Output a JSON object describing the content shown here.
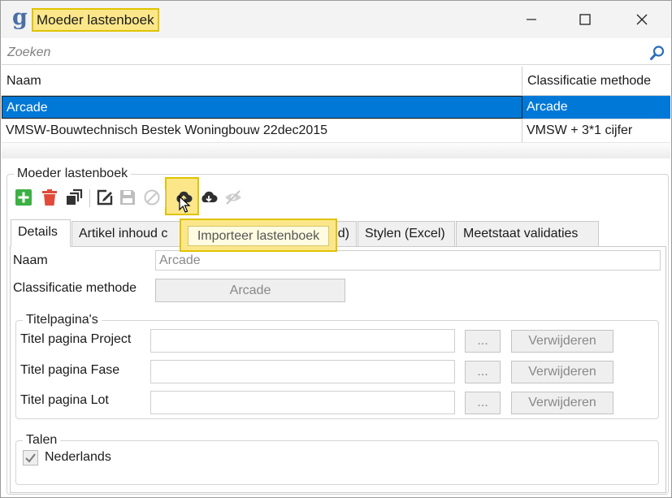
{
  "window": {
    "title": "Moeder lastenboek",
    "logo_letter": "g",
    "controls": {
      "minimize": "minimize-icon",
      "maximize": "maximize-icon",
      "close": "close-icon"
    }
  },
  "search": {
    "placeholder": "Zoeken",
    "value": ""
  },
  "grid": {
    "columns": [
      "Naam",
      "Classificatie methode"
    ],
    "rows": [
      {
        "naam": "Arcade",
        "classificatie": "Arcade",
        "selected": true
      },
      {
        "naam": "VMSW-Bouwtechnisch Bestek Woningbouw 22dec2015",
        "classificatie": "VMSW + 3*1 cijfer",
        "selected": false
      }
    ]
  },
  "group_title": "Moeder lastenboek",
  "toolbar": {
    "icons": [
      "add-icon",
      "delete-icon",
      "copy-icon",
      "edit-icon",
      "save-icon",
      "cancel-icon",
      "import-icon",
      "download-icon",
      "hide-icon"
    ],
    "tooltip": "Importeer lastenboek"
  },
  "tabs": [
    {
      "label": "Details",
      "active": true
    },
    {
      "label": "Artikel inhoud c",
      "active": false
    },
    {
      "label": "d)",
      "active": false
    },
    {
      "label": "Stylen (Excel)",
      "active": false
    },
    {
      "label": "Meetstaat validaties",
      "active": false
    }
  ],
  "details": {
    "naam_label": "Naam",
    "naam_value": "Arcade",
    "classificatie_label": "Classificatie methode",
    "classificatie_value": "Arcade",
    "titelpaginas_title": "Titelpagina's",
    "titel_rows": [
      {
        "label": "Titel pagina Project",
        "value": "",
        "browse": "...",
        "remove": "Verwijderen"
      },
      {
        "label": "Titel pagina Fase",
        "value": "",
        "browse": "...",
        "remove": "Verwijderen"
      },
      {
        "label": "Titel pagina Lot",
        "value": "",
        "browse": "...",
        "remove": "Verwijderen"
      }
    ],
    "talen_title": "Talen",
    "talen": [
      {
        "label": "Nederlands",
        "checked": true
      }
    ]
  },
  "colors": {
    "selection": "#0078d7",
    "highlight": "#fbe78a",
    "highlight_border": "#e0c300",
    "add_green": "#3cb043",
    "delete_red": "#e04b3a"
  }
}
